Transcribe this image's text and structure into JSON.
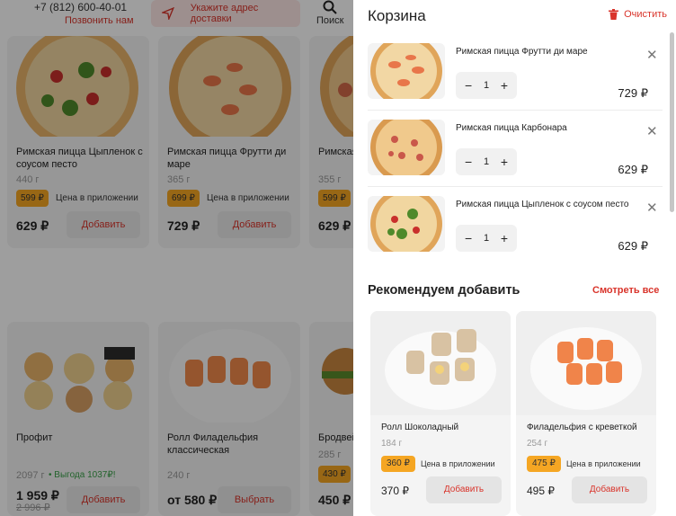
{
  "header": {
    "phone": "+7 (812) 600-40-01",
    "callback": "Позвонить нам",
    "address_placeholder": "Укажите адрес доставки",
    "search": "Поиск"
  },
  "products": [
    {
      "name": "Римская пицца Цыпленок с соусом песто",
      "weight": "440 г",
      "badge": "599 ₽",
      "badge_label": "Цена в приложении",
      "price": "629 ₽",
      "button": "Добавить"
    },
    {
      "name": "Римская пицца Фрутти ди маре",
      "weight": "365 г",
      "badge": "699 ₽",
      "badge_label": "Цена в приложении",
      "price": "729 ₽",
      "button": "Добавить"
    },
    {
      "name": "Римская пицца ...",
      "weight": "355 г",
      "badge": "599 ₽",
      "price": "629 ₽"
    },
    {
      "name": "Профит",
      "weight": "2097 г",
      "note": "• Выгода 1037₽!",
      "price": "1 959 ₽",
      "old_price": "2 996 ₽",
      "button": "Добавить"
    },
    {
      "name": "Ролл Филадельфия классическая",
      "weight": "240 г",
      "price": "от 580 ₽",
      "button": "Выбрать"
    },
    {
      "name": "Бродвей",
      "weight": "285 г",
      "badge": "430 ₽",
      "price": "450 ₽"
    }
  ],
  "cart": {
    "title": "Корзина",
    "clear_label": "Очистить",
    "items": [
      {
        "name": "Римская пицца Фрутти ди маре",
        "qty": "1",
        "price": "729 ₽"
      },
      {
        "name": "Римская пицца Карбонара",
        "qty": "1",
        "price": "629 ₽"
      },
      {
        "name": "Римская пицца Цыпленок с соусом песто",
        "qty": "1",
        "price": "629 ₽"
      }
    ],
    "minus": "−",
    "plus": "+",
    "close": "✕"
  },
  "recommend": {
    "title": "Рекомендуем добавить",
    "see_all": "Смотреть все",
    "items": [
      {
        "name": "Ролл Шоколадный",
        "weight": "184 г",
        "badge": "360 ₽",
        "badge_label": "Цена в приложении",
        "price": "370 ₽",
        "button": "Добавить"
      },
      {
        "name": "Филадельфия с креветкой",
        "weight": "254 г",
        "badge": "475 ₽",
        "badge_label": "Цена в приложении",
        "price": "495 ₽",
        "button": "Добавить"
      }
    ]
  },
  "colors": {
    "accent": "#d9342b",
    "badge": "#f5a623"
  }
}
